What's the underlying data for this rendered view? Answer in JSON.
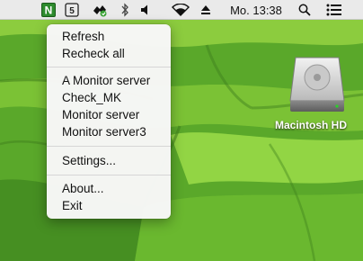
{
  "menubar": {
    "clock": "Mo. 13:38",
    "icons": [
      "nagstamon-icon",
      "shield-badge-icon",
      "puzzle-sync-icon",
      "bluetooth-icon",
      "volume-icon",
      "wifi-icon",
      "eject-icon",
      "search-icon",
      "notification-list-icon"
    ],
    "nagstamon_letter": "N",
    "badge_number": "5"
  },
  "dropdown": {
    "items": [
      "Refresh",
      "Recheck all",
      "A Monitor server",
      "Check_MK",
      "Monitor server",
      "Monitor server3",
      "Settings...",
      "About...",
      "Exit"
    ]
  },
  "desktop": {
    "disk_label": "Macintosh HD"
  },
  "colors": {
    "menubar_bg": "#eaeaea",
    "menu_bg": "#f7f7f7",
    "grass_light": "#8fd13e",
    "grass_dark": "#3a8a1f",
    "nagstamon_green": "#2e8b2e"
  }
}
